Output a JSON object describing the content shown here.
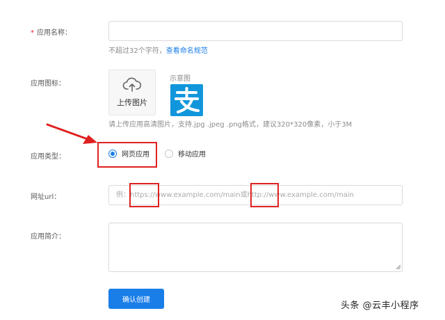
{
  "form": {
    "name": {
      "required_mark": "*",
      "label": "应用名称：",
      "value": "",
      "hint": "不超过32个字符，",
      "hint_link": "查看命名规范"
    },
    "icon": {
      "label": "应用图标：",
      "upload_label": "上传图片",
      "sample_label": "示意图",
      "sample_icon": "alipay-logo",
      "hint": "请上传应用高清图片，支持.jpg .jpeg .png格式，建议320*320像素，小于3M"
    },
    "type": {
      "label": "应用类型：",
      "options": [
        {
          "label": "网页应用",
          "checked": true
        },
        {
          "label": "移动应用",
          "checked": false
        }
      ]
    },
    "url": {
      "label": "网址url：",
      "placeholder": "例：https://www.example.com/main或http://www.example.com/main"
    },
    "intro": {
      "label": "应用简介：",
      "value": ""
    },
    "submit_label": "确认创建"
  },
  "colors": {
    "accent": "#1a7ee8",
    "annotation": "#e02020",
    "logo_bg": "#1296db"
  },
  "watermark": "头条 @云丰小程序"
}
